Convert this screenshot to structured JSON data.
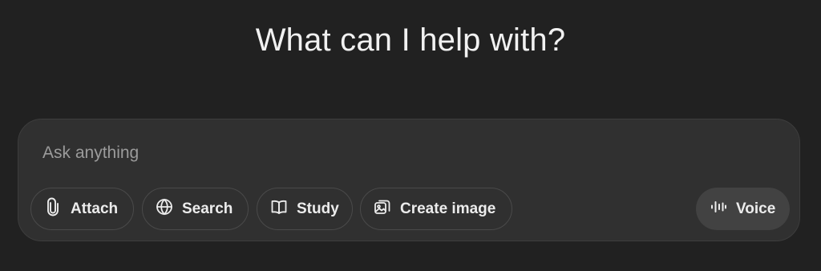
{
  "heading": "What can I help with?",
  "composer": {
    "placeholder": "Ask anything",
    "tools": {
      "attach": "Attach",
      "search": "Search",
      "study": "Study",
      "create_image": "Create image"
    },
    "voice": "Voice"
  },
  "icons": {
    "attach": "paperclip-icon",
    "search": "globe-icon",
    "study": "book-icon",
    "create_image": "image-icon",
    "voice": "waveform-icon"
  },
  "colors": {
    "background": "#212121",
    "composer": "#303030",
    "text": "#ececec",
    "placeholder": "#9b9b9b",
    "voice_button": "#424242"
  }
}
